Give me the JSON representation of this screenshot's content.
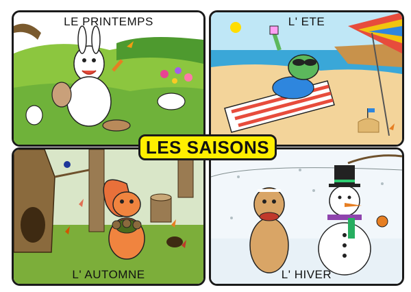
{
  "title": "LES SAISONS",
  "panels": {
    "spring": {
      "caption": "LE PRINTEMPS"
    },
    "summer": {
      "caption": "L' ETE"
    },
    "autumn": {
      "caption": "L' AUTOMNE"
    },
    "winter": {
      "caption": "L' HIVER"
    }
  },
  "colors": {
    "title_background": "#ffef00",
    "border": "#1a1a1a",
    "spring_grass": "#8cc63f",
    "summer_sand": "#f3d49a",
    "autumn_ground": "#7cae3a",
    "winter_snow": "#e8f1f7"
  }
}
